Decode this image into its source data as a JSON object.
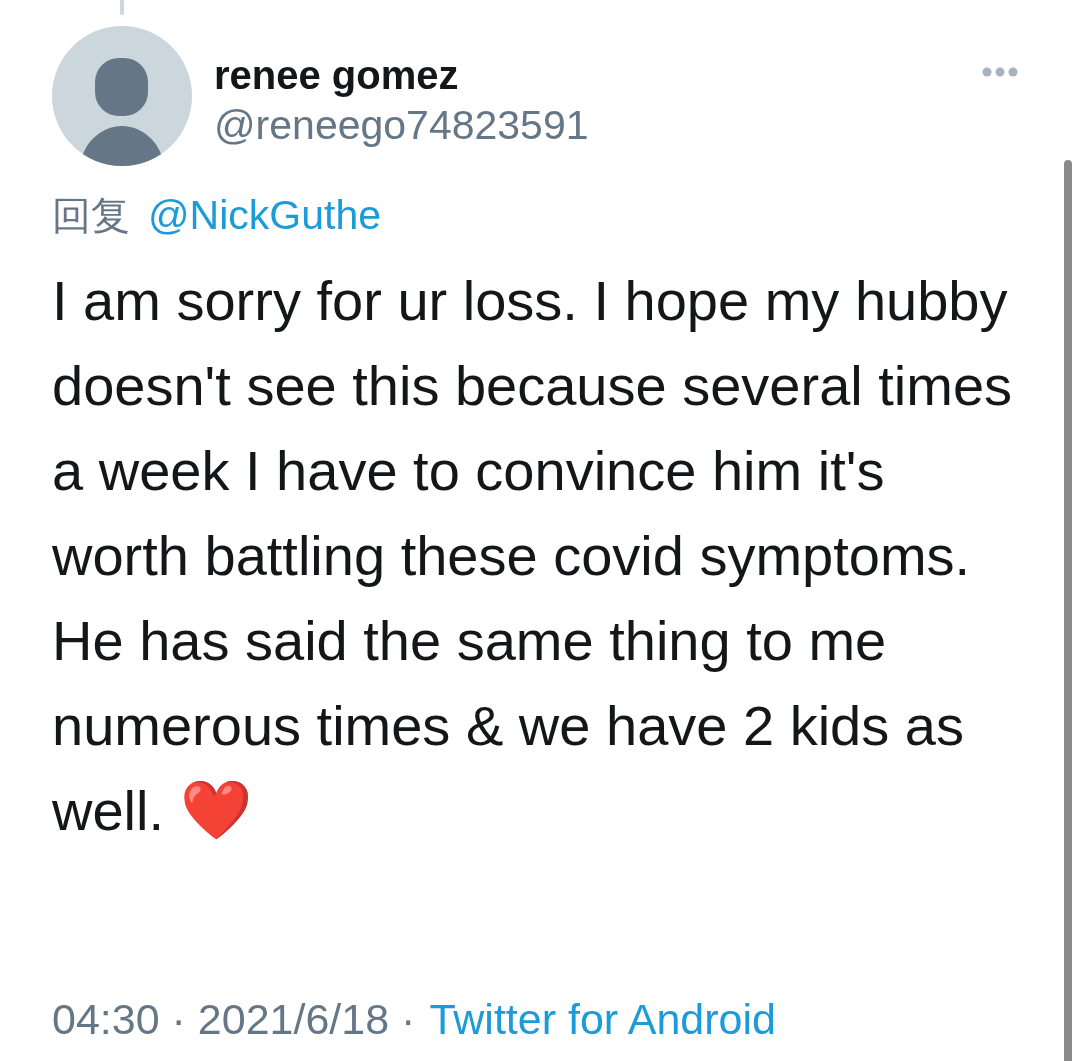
{
  "author": {
    "name": "renee gomez",
    "handle": "@reneego74823591"
  },
  "reply_to": {
    "label": "回复",
    "mention": "@NickGuthe"
  },
  "tweet": {
    "text": "I am sorry for ur loss. I hope my hubby doesn't see this because several times a week I have to convince him it's worth battling these covid symptoms. He has said the same thing to me numerous times & we have 2 kids as well. ❤️"
  },
  "meta": {
    "timestamp": "04:30 · 2021/6/18 ·",
    "source": "Twitter for Android"
  }
}
